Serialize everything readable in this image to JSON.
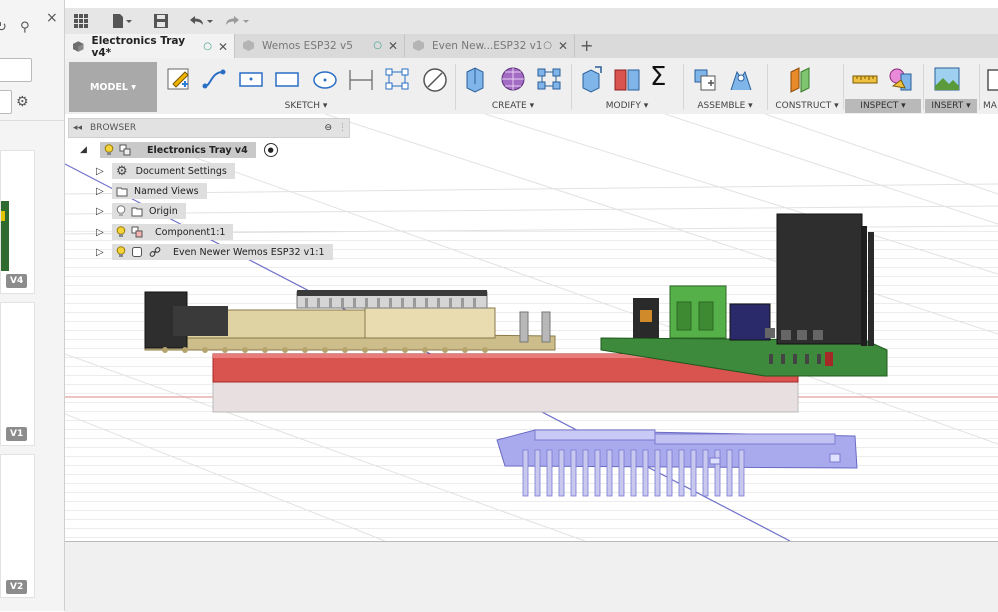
{
  "window": {
    "tabs": [
      {
        "label": "Electronics Tray v4*",
        "active": true
      },
      {
        "label": "Wemos ESP32 v5",
        "active": false
      },
      {
        "label": "Even New...ESP32 v1",
        "active": false
      }
    ],
    "add_tab_label": "+"
  },
  "left_panel": {
    "versions": [
      "V4",
      "V1",
      "V2"
    ],
    "close_label": "×"
  },
  "ribbon": {
    "workspace": "MODEL",
    "groups": [
      "SKETCH",
      "CREATE",
      "MODIFY",
      "ASSEMBLE",
      "CONSTRUCT",
      "INSPECT",
      "INSERT",
      "MA"
    ],
    "sigma_glyph": "Σ"
  },
  "browser": {
    "title": "BROWSER",
    "root": "Electronics Tray v4",
    "items": [
      {
        "label": "Document Settings",
        "icon": "gear-icon"
      },
      {
        "label": "Named Views",
        "icon": "folder-icon"
      },
      {
        "label": "Origin",
        "icon": "folder-icon"
      },
      {
        "label": "Component1:1",
        "icon": "component-icon"
      },
      {
        "label": "Even Newer Wemos ESP32 v1:1",
        "icon": "link-icon"
      }
    ]
  },
  "colors": {
    "accent_tab_dot": "#3b9d8e",
    "base_plate": "#d9534f",
    "pcb_green": "#3d8a3d",
    "esp_board": "#a9a9ee",
    "connector_tan": "#d8c99a"
  }
}
